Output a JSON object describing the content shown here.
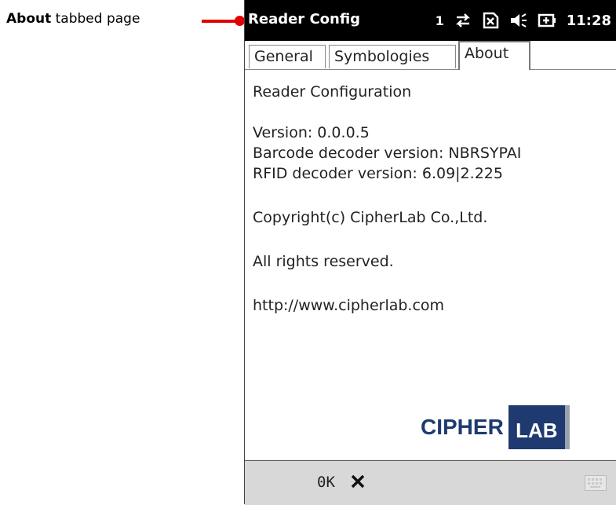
{
  "callout": {
    "bold": "About",
    "rest": " tabbed page"
  },
  "titlebar": {
    "title": "Reader Config",
    "signal_number": "1",
    "clock": "11:28"
  },
  "tabs": [
    {
      "label": "General"
    },
    {
      "label": "Symbologies"
    },
    {
      "label": "About",
      "selected": true
    }
  ],
  "about": {
    "heading": "Reader Configuration",
    "version": "Version: 0.0.0.5",
    "barcode_version": "Barcode decoder version: NBRSYPAI",
    "rfid_version": "RFID decoder version: 6.09|2.225",
    "copyright": "Copyright(c) CipherLab Co.,Ltd.",
    "rights": "All rights reserved.",
    "url": "http://www.cipherlab.com"
  },
  "logo": {
    "cipher": "CIPHER",
    "lab": "LAB"
  },
  "bottombar": {
    "ok_label": "0K",
    "close_icon": "close-icon",
    "keyboard_icon": "keyboard-icon"
  },
  "colors": {
    "callout": "#e00000",
    "brand": "#1f3a70"
  }
}
